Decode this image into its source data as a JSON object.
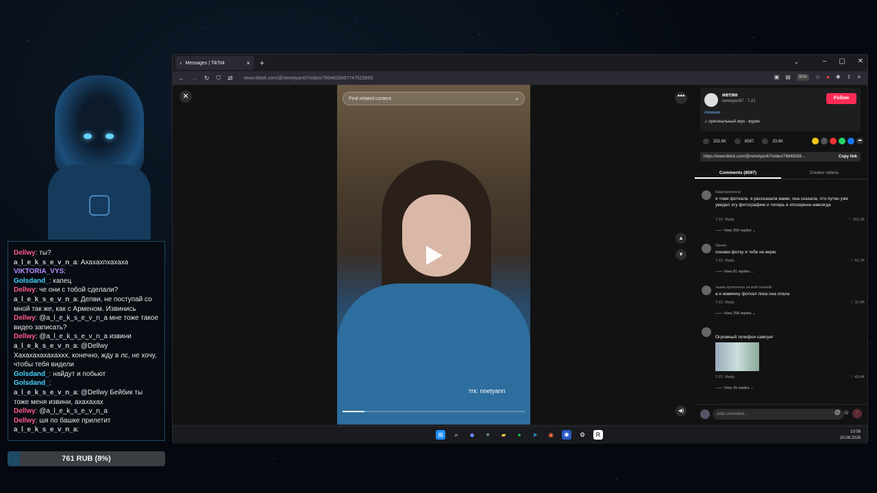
{
  "overlay": {
    "chat": [
      {
        "nick": "Dellwy",
        "color": "#ff5a8a",
        "text": ": ты?"
      },
      {
        "nick": "a_l_e_k_s_e_v_n_a",
        "color": "#c9c9c9",
        "text": ": Ахахахпхахаха"
      },
      {
        "nick": "VIKTORIA_VYS",
        "color": "#b48cff",
        "text": ":"
      },
      {
        "nick": "Golsdand_",
        "color": "#47d3ff",
        "text": ": капец"
      },
      {
        "nick": "Dellwy",
        "color": "#ff5a8a",
        "text": ": че они с тобой сделали?"
      },
      {
        "nick": "a_l_e_k_s_e_v_n_a",
        "color": "#c9c9c9",
        "text": ": Делви, не поступай со мной так же, как с Арменом. Извинись"
      },
      {
        "nick": "Dellwy",
        "color": "#ff5a8a",
        "text": ": @a_l_e_k_s_e_v_n_a мне тоже такое видео записать?"
      },
      {
        "nick": "Dellwy",
        "color": "#ff5a8a",
        "text": ": @a_l_e_k_s_e_v_n_a извини"
      },
      {
        "nick": "a_l_e_k_s_e_v_n_a",
        "color": "#c9c9c9",
        "text": ": @Dellwy Хахахахахахаххх, конечно, жду в лс, не хочу, чтобы тебя видели"
      },
      {
        "nick": "Golsdand_",
        "color": "#47d3ff",
        "text": ": найдут и побьют"
      },
      {
        "nick": "Golsdand_",
        "color": "#47d3ff",
        "text": ":"
      },
      {
        "nick": "a_l_e_k_s_e_v_n_a",
        "color": "#c9c9c9",
        "text": ": @Dellwy Бейбик ты тоже меня извини, ахахахах"
      },
      {
        "nick": "Dellwy",
        "color": "#ff5a8a",
        "text": ": @a_l_e_k_s_e_v_n_a"
      },
      {
        "nick": "Dellwy",
        "color": "#ff5a8a",
        "text": ": шя по башке прилетит"
      },
      {
        "nick": "a_l_e_k_s_e_v_n_a",
        "color": "#c9c9c9",
        "text": ":"
      }
    ],
    "donation": {
      "label": "761 RUB (8%)",
      "progress_percent": 8
    }
  },
  "browser": {
    "tab_title": "Messages | TikTok",
    "new_tab": "+",
    "url": "www.tiktok.com/@nenetyan67/video/7664828867747515656",
    "zoom": "90%",
    "controls": {
      "minimize": "–",
      "maximize": "▢",
      "close": "✕"
    }
  },
  "tiktok": {
    "search_placeholder": "Find related content",
    "video_watermark": "тгк: nnetyann",
    "video_progress": 0.12,
    "author": {
      "name": "нетян",
      "handle_date": "nenetyan67 · 7-21",
      "follow_label": "Follow",
      "tag": "#япония",
      "music": "♫ оригинальный звук - мурик"
    },
    "stats": {
      "likes": "332.6K",
      "comments": "8597",
      "saves": "33.8K"
    },
    "link": "https://www.tiktok.com/@nenetyan67/video/76648288...",
    "copy_label": "Copy link",
    "tabs": [
      "Comments (8597)",
      "Creator videos"
    ],
    "comments": [
      {
        "user": "fatalexperience",
        "text": "я тоже фоткала. я рассказала маме, она сказала, что путин уже увидел эту фотографию и теперь я опозорена навсегда",
        "date": "7-21",
        "reply": "Reply",
        "likes": "161.2K",
        "replies": "View 250 replies"
      },
      {
        "user": "Орлин",
        "text": "покажи фотку я тебе не верю",
        "date": "7-21",
        "reply": "Reply",
        "likes": "51.7K",
        "replies": "View 81 replies"
      },
      {
        "user": "тыква проклятых за мой снежой",
        "text": "а я маминку фоткал пока она спала",
        "date": "7-21",
        "reply": "Reply",
        "likes": "12.9K",
        "replies": "View 258 replies"
      },
      {
        "user": "",
        "text": "Огромный телефон самсунг",
        "date": "7-21",
        "reply": "Reply",
        "likes": "43.4K",
        "replies": "View 26 replies"
      }
    ],
    "add_comment_placeholder": "Add comment..."
  },
  "taskbar": {
    "time": "10:08",
    "date": "20.08.2026"
  }
}
